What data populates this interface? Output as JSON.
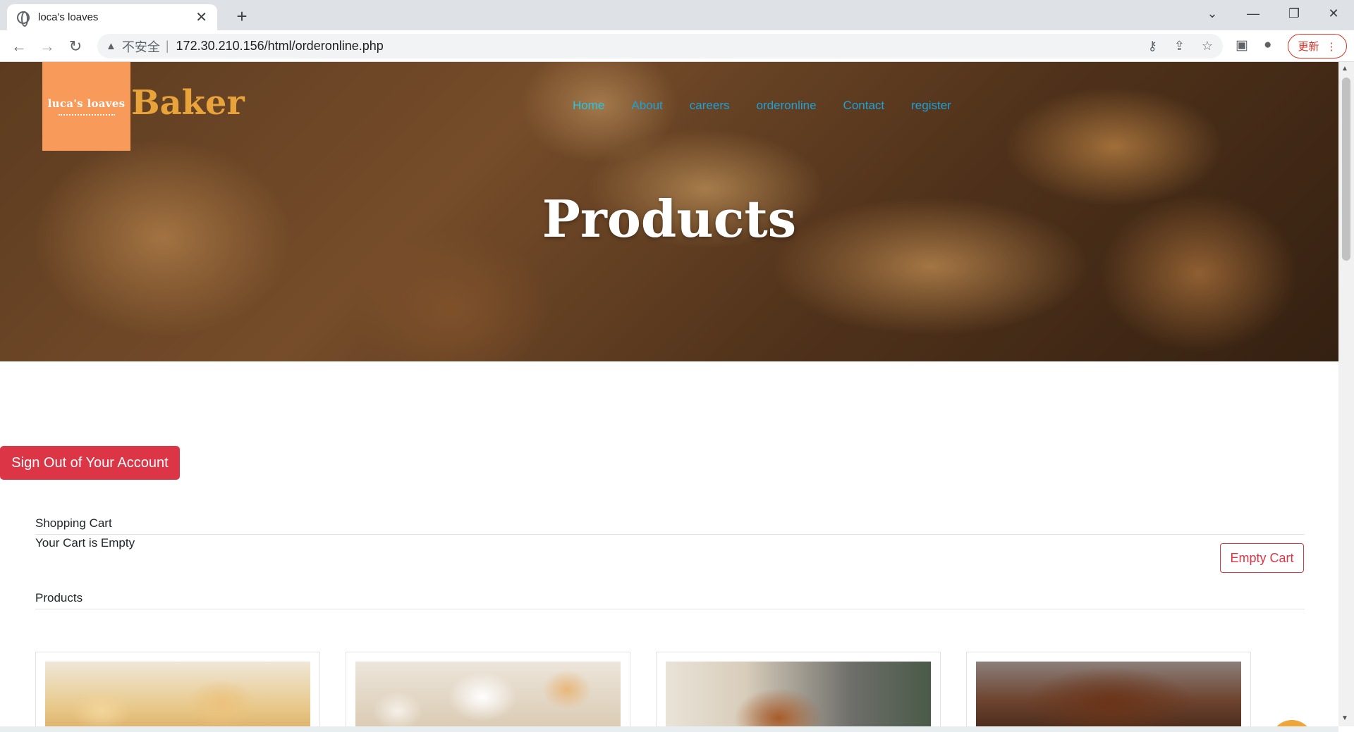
{
  "browser": {
    "tab_title": "loca's loaves",
    "url_warning": "不安全",
    "url_separator": "|",
    "url": "172.30.210.156/html/orderonline.php",
    "update_label": "更新"
  },
  "site": {
    "logo_text": "luca's loaves",
    "brand": "Baker",
    "nav": [
      "Home",
      "About",
      "careers",
      "orderonline",
      "Contact",
      "register"
    ],
    "hero_title": "Products"
  },
  "content": {
    "signout_label": "Sign Out of Your Account",
    "cart_heading": "Shopping Cart",
    "cart_status": "Your Cart is Empty",
    "empty_cart_label": "Empty Cart",
    "products_heading": "Products"
  },
  "colors": {
    "brand": "#e8a33a",
    "nav_link": "#1ea1d6",
    "danger": "#dc3545",
    "logo_bg": "#f79a5a",
    "to_top": "#eea53a"
  },
  "icons": {
    "tab": "globe-icon",
    "back": "back-arrow-icon",
    "forward": "forward-arrow-icon",
    "reload": "reload-icon",
    "key": "key-icon",
    "share": "share-icon",
    "bookmark": "star-icon",
    "sidepanel": "side-panel-icon",
    "profile": "profile-icon",
    "to_top": "arrow-up-icon"
  }
}
